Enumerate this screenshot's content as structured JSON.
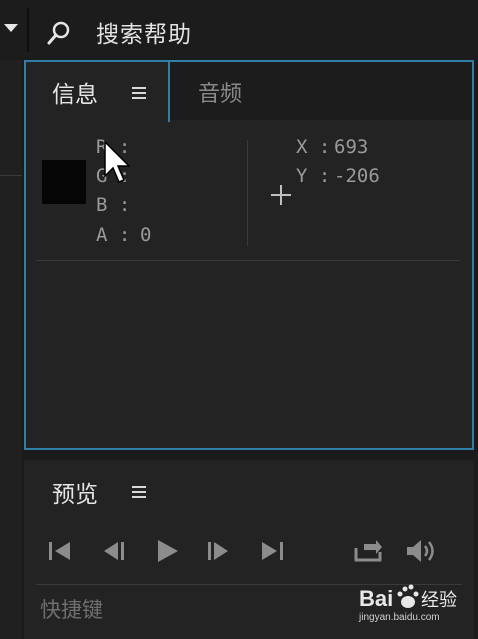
{
  "toolbar": {
    "search_label": "搜索帮助"
  },
  "info_panel": {
    "tabs": [
      {
        "label": "信息",
        "active": true
      },
      {
        "label": "音频",
        "active": false
      }
    ],
    "color": {
      "r_label": "R :",
      "g_label": "G :",
      "b_label": "B :",
      "a_label": "A :",
      "a_value": "0",
      "swatch_color": "#050505"
    },
    "position": {
      "x_label": "X :",
      "x_value": "693",
      "y_label": "Y :",
      "y_value": "-206"
    }
  },
  "preview_panel": {
    "title": "预览",
    "shortcut_label": "快捷键"
  },
  "colors": {
    "accent": "#2f7fa6",
    "panel_bg": "#232323",
    "app_bg": "#1b1b1b"
  },
  "watermark": {
    "logo_text": "Bai",
    "logo_suffix": "经验",
    "url": "jingyan.baidu.com"
  }
}
